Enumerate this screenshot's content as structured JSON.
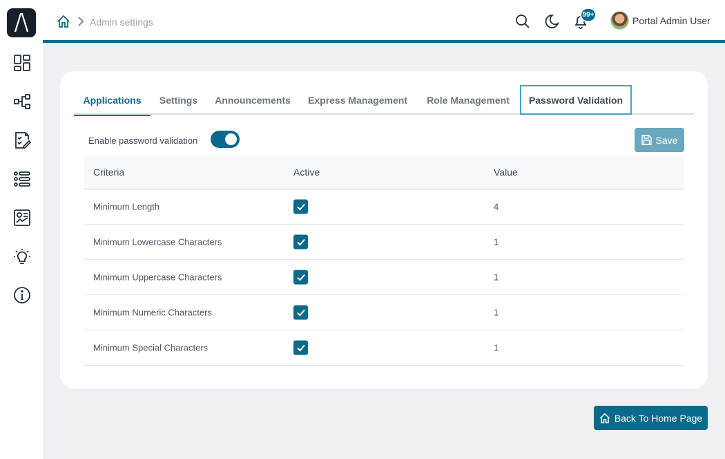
{
  "header": {
    "breadcrumb": "Admin settings",
    "notification_badge": "99+",
    "user_name": "Portal Admin User"
  },
  "tabs": [
    {
      "label": "Applications",
      "active": true
    },
    {
      "label": "Settings"
    },
    {
      "label": "Announcements"
    },
    {
      "label": "Express Management"
    },
    {
      "label": "Role Management"
    },
    {
      "label": "Password Validation",
      "focused": true
    }
  ],
  "toggle": {
    "label": "Enable password validation",
    "on": true
  },
  "save_label": "Save",
  "table": {
    "columns": [
      "Criteria",
      "Active",
      "Value"
    ],
    "rows": [
      {
        "criteria": "Minimum Length",
        "active": true,
        "value": "4"
      },
      {
        "criteria": "Minimum Lowercase Characters",
        "active": true,
        "value": "1"
      },
      {
        "criteria": "Minimum Uppercase Characters",
        "active": true,
        "value": "1"
      },
      {
        "criteria": "Minimum Numeric Characters",
        "active": true,
        "value": "1"
      },
      {
        "criteria": "Minimum Special Characters",
        "active": true,
        "value": "1"
      }
    ]
  },
  "back_label": "Back To Home Page",
  "colors": {
    "accent": "#0a6a8c",
    "save_disabled": "#69a8be",
    "focus_outline": "#3aa7c9"
  }
}
